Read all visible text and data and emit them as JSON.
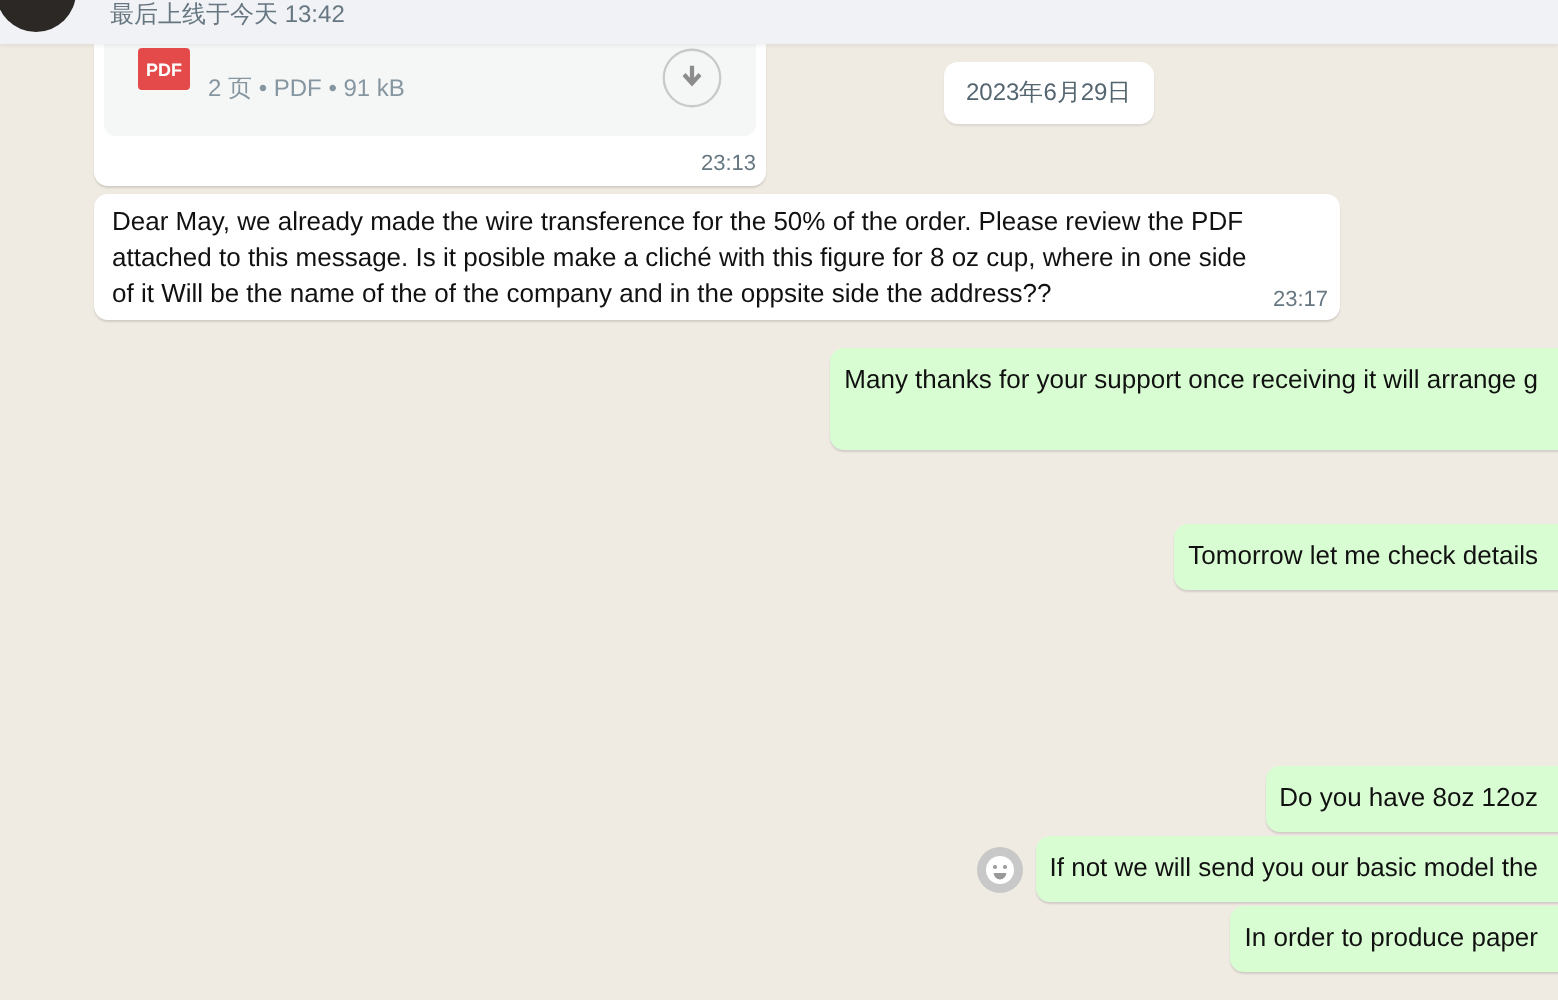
{
  "header": {
    "status": "最后上线于今天 13:42"
  },
  "date_chip": "2023年6月29日",
  "messages": [
    {
      "kind": "file",
      "incoming": true,
      "meta": "2 页 • PDF • 91 kB",
      "icon_label": "PDF",
      "time": "23:13"
    },
    {
      "kind": "text",
      "incoming": true,
      "text": "Dear May, we already made the wire transference for the 50% of the order. Please review the PDF attached to this message. Is it posible make a cliché with this figure for 8 oz cup, where in one side of it Will be the name of the of the company and in the oppsite side the address??",
      "time": "23:17"
    },
    {
      "kind": "text",
      "incoming": false,
      "text": "Many thanks for your support once receiving it will arrange g"
    },
    {
      "kind": "text",
      "incoming": false,
      "text": "Tomorrow let me check details"
    },
    {
      "kind": "text",
      "incoming": false,
      "text": "Do you have 8oz 12oz"
    },
    {
      "kind": "text",
      "incoming": false,
      "text": "If not we will send you our basic model the",
      "reaction": true
    },
    {
      "kind": "text",
      "incoming": false,
      "text": "In order to produce paper"
    }
  ]
}
